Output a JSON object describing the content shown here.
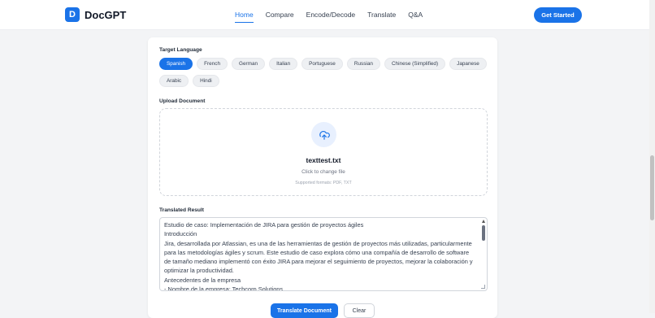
{
  "header": {
    "brand_letter": "D",
    "brand_name": "DocGPT",
    "nav": [
      "Home",
      "Compare",
      "Encode/Decode",
      "Translate",
      "Q&A"
    ],
    "active_nav": "Home",
    "cta_label": "Get Started"
  },
  "target_language": {
    "label": "Target Language",
    "options": [
      "Spanish",
      "French",
      "German",
      "Italian",
      "Portuguese",
      "Russian",
      "Chinese (Simplified)",
      "Japanese",
      "Arabic",
      "Hindi"
    ],
    "selected": "Spanish"
  },
  "upload": {
    "label": "Upload Document",
    "file_name": "texttest.txt",
    "change_hint": "Click to change file",
    "formats": "Supported formats: PDF, TXT",
    "icon": "upload-cloud-icon"
  },
  "result": {
    "label": "Translated Result",
    "text": "Estudio de caso: Implementación de JIRA para gestión de proyectos ágiles\nIntroducción\nJira, desarrollada por Atlassian, es una de las herramientas de gestión de proyectos más utilizadas, particularmente para las metodologías ágiles y scrum. Este estudio de caso explora cómo una compañía de desarrollo de software de tamaño mediano implementó con éxito JIRA para mejorar el seguimiento de proyectos, mejorar la colaboración y optimizar la productividad.\nAntecedentes de la empresa\n- Nombre de la empresa: Techcorp Solutions"
  },
  "actions": {
    "translate_label": "Translate Document",
    "clear_label": "Clear"
  },
  "colors": {
    "accent": "#1a73e8",
    "background": "#f3f4f6"
  }
}
